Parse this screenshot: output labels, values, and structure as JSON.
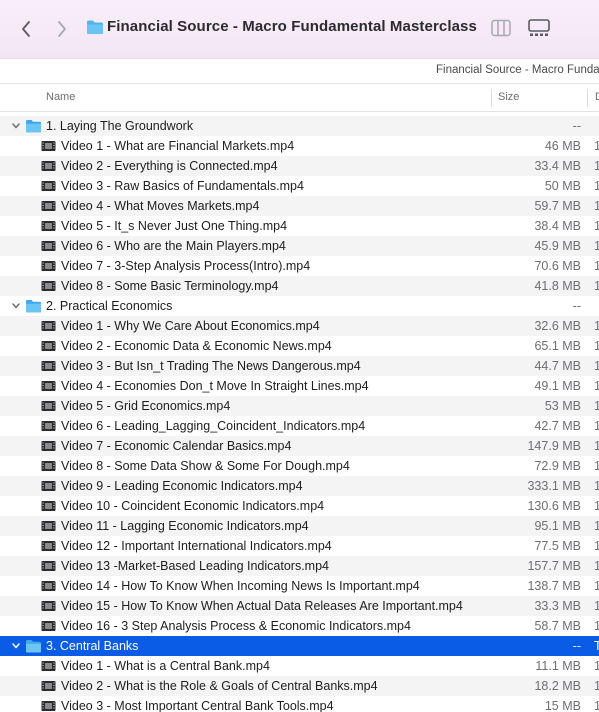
{
  "window": {
    "title": "Financial Source - Macro Fundamental Masterclass",
    "path_text": "Financial Source - Macro Funda"
  },
  "columns": {
    "name": "Name",
    "size": "Size",
    "extra": "D"
  },
  "colors": {
    "selection": "#0a5ce6",
    "folder": "#4fb3f0",
    "toolbar": "#f6ebf6"
  },
  "rows": [
    {
      "type": "folder",
      "name": "1. Laying The Groundwork",
      "size": "--",
      "tail": "",
      "expanded": true
    },
    {
      "type": "file",
      "name": "Video 1 - What are Financial Markets.mp4",
      "size": "46 MB",
      "tail": "1"
    },
    {
      "type": "file",
      "name": "Video 2 - Everything is Connected.mp4",
      "size": "33.4 MB",
      "tail": "1"
    },
    {
      "type": "file",
      "name": "Video 3 - Raw Basics of Fundamentals.mp4",
      "size": "50 MB",
      "tail": "1"
    },
    {
      "type": "file",
      "name": "Video 4 - What Moves Markets.mp4",
      "size": "59.7 MB",
      "tail": "1"
    },
    {
      "type": "file",
      "name": "Video 5 - It_s Never Just One Thing.mp4",
      "size": "38.4 MB",
      "tail": "1"
    },
    {
      "type": "file",
      "name": "Video 6 - Who are the Main Players.mp4",
      "size": "45.9 MB",
      "tail": "1"
    },
    {
      "type": "file",
      "name": "Video 7 - 3-Step Analysis Process(Intro).mp4",
      "size": "70.6 MB",
      "tail": "1"
    },
    {
      "type": "file",
      "name": "Video 8 - Some Basic Terminology.mp4",
      "size": "41.8 MB",
      "tail": "1"
    },
    {
      "type": "folder",
      "name": "2. Practical Economics",
      "size": "--",
      "tail": "",
      "expanded": true
    },
    {
      "type": "file",
      "name": "Video 1 - Why We Care About Economics.mp4",
      "size": "32.6 MB",
      "tail": "1"
    },
    {
      "type": "file",
      "name": "Video 2 - Economic Data & Economic News.mp4",
      "size": "65.1 MB",
      "tail": "1"
    },
    {
      "type": "file",
      "name": "Video 3 - But Isn_t Trading The News Dangerous.mp4",
      "size": "44.7 MB",
      "tail": "1"
    },
    {
      "type": "file",
      "name": "Video 4 - Economies Don_t Move In Straight Lines.mp4",
      "size": "49.1 MB",
      "tail": "1"
    },
    {
      "type": "file",
      "name": "Video 5 - Grid Economics.mp4",
      "size": "53 MB",
      "tail": "1"
    },
    {
      "type": "file",
      "name": "Video 6 - Leading_Lagging_Coincident_Indicators.mp4",
      "size": "42.7 MB",
      "tail": "1"
    },
    {
      "type": "file",
      "name": "Video 7 - Economic Calendar Basics.mp4",
      "size": "147.9 MB",
      "tail": "1"
    },
    {
      "type": "file",
      "name": "Video 8 - Some Data Show & Some For Dough.mp4",
      "size": "72.9 MB",
      "tail": "1"
    },
    {
      "type": "file",
      "name": "Video 9 - Leading Economic Indicators.mp4",
      "size": "333.1 MB",
      "tail": "1"
    },
    {
      "type": "file",
      "name": "Video 10 - Coincident Economic Indicators.mp4",
      "size": "130.6 MB",
      "tail": "1"
    },
    {
      "type": "file",
      "name": "Video 11 - Lagging Economic Indicators.mp4",
      "size": "95.1 MB",
      "tail": "1"
    },
    {
      "type": "file",
      "name": "Video 12 - Important International Indicators.mp4",
      "size": "77.5 MB",
      "tail": "1"
    },
    {
      "type": "file",
      "name": "Video 13 -Market-Based Leading Indicators.mp4",
      "size": "157.7 MB",
      "tail": "1"
    },
    {
      "type": "file",
      "name": "Video 14 - How To Know When Incoming News Is Important.mp4",
      "size": "138.7 MB",
      "tail": "1"
    },
    {
      "type": "file",
      "name": "Video 15 - How To Know When Actual Data Releases Are Important.mp4",
      "size": "33.3 MB",
      "tail": "1"
    },
    {
      "type": "file",
      "name": "Video 16 - 3 Step Analysis Process & Economic Indicators.mp4",
      "size": "58.7 MB",
      "tail": "1"
    },
    {
      "type": "folder",
      "name": "3. Central Banks",
      "size": "--",
      "tail": "T",
      "expanded": true,
      "selected": true
    },
    {
      "type": "file",
      "name": "Video 1 - What is a Central Bank.mp4",
      "size": "11.1 MB",
      "tail": "1"
    },
    {
      "type": "file",
      "name": "Video 2 - What is the Role & Goals of Central Banks.mp4",
      "size": "18.2 MB",
      "tail": "1"
    },
    {
      "type": "file",
      "name": "Video 3 - Most Important Central Bank Tools.mp4",
      "size": "15 MB",
      "tail": "1"
    }
  ]
}
